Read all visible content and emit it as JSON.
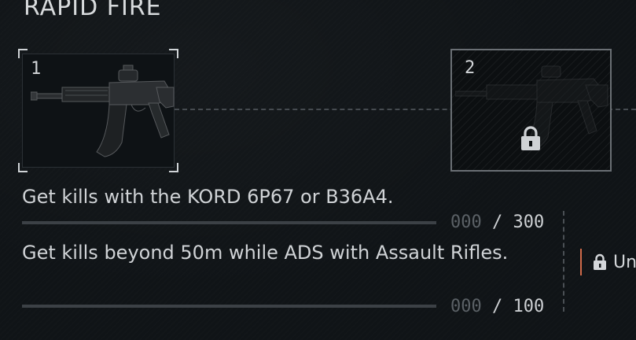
{
  "section": {
    "title": "RAPID FIRE"
  },
  "tiers": [
    {
      "number": "1",
      "locked": false,
      "weapon_icon": "assault-rifle-icon"
    },
    {
      "number": "2",
      "locked": true,
      "weapon_icon": "assault-rifle-icon",
      "lock_icon": "padlock-icon"
    }
  ],
  "challenges": [
    {
      "text": "Get kills with the KORD 6P67 or B36A4.",
      "progress_current": "000",
      "progress_separator": "/",
      "progress_total": "300",
      "progress_fraction": 0
    },
    {
      "text": "Get kills beyond 50m while ADS with Assault Rifles.",
      "progress_current": "000",
      "progress_separator": "/",
      "progress_total": "100",
      "progress_fraction": 0
    }
  ],
  "unlock": {
    "label": "Un",
    "icon": "padlock-icon",
    "accent_color": "#d06a4a"
  },
  "colors": {
    "background": "#101417",
    "text": "#d0d3d6",
    "progress_track": "#3c4146"
  }
}
